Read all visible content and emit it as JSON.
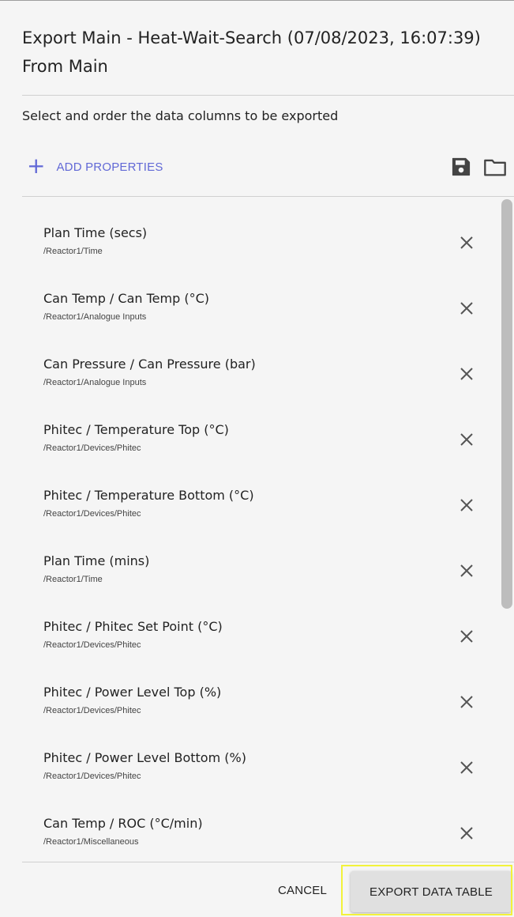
{
  "dialog": {
    "title_line1": "Export Main - Heat-Wait-Search (07/08/2023, 16:07:39)",
    "title_line2": "From Main",
    "subtitle": "Select and order the data columns to be exported"
  },
  "toolbar": {
    "add_properties_label": "ADD PROPERTIES",
    "icons": [
      "plus-icon",
      "save-icon",
      "folder-icon"
    ]
  },
  "columns": [
    {
      "title": "Plan Time (secs)",
      "path": "/Reactor1/Time"
    },
    {
      "title": "Can Temp / Can Temp (°C)",
      "path": "/Reactor1/Analogue Inputs"
    },
    {
      "title": "Can Pressure / Can Pressure (bar)",
      "path": "/Reactor1/Analogue Inputs"
    },
    {
      "title": "Phitec / Temperature Top (°C)",
      "path": "/Reactor1/Devices/Phitec"
    },
    {
      "title": "Phitec / Temperature Bottom (°C)",
      "path": "/Reactor1/Devices/Phitec"
    },
    {
      "title": "Plan Time (mins)",
      "path": "/Reactor1/Time"
    },
    {
      "title": "Phitec / Phitec Set Point (°C)",
      "path": "/Reactor1/Devices/Phitec"
    },
    {
      "title": "Phitec / Power Level Top (%)",
      "path": "/Reactor1/Devices/Phitec"
    },
    {
      "title": "Phitec / Power Level Bottom (%)",
      "path": "/Reactor1/Devices/Phitec"
    },
    {
      "title": "Can Temp / ROC (°C/min)",
      "path": "/Reactor1/Miscellaneous"
    }
  ],
  "footer": {
    "cancel_label": "CANCEL",
    "export_label": "EXPORT DATA TABLE"
  },
  "colors": {
    "accent": "#6168d6",
    "highlight": "#f2f23a",
    "background": "#f5f5f5",
    "button": "#e0e0e0"
  }
}
